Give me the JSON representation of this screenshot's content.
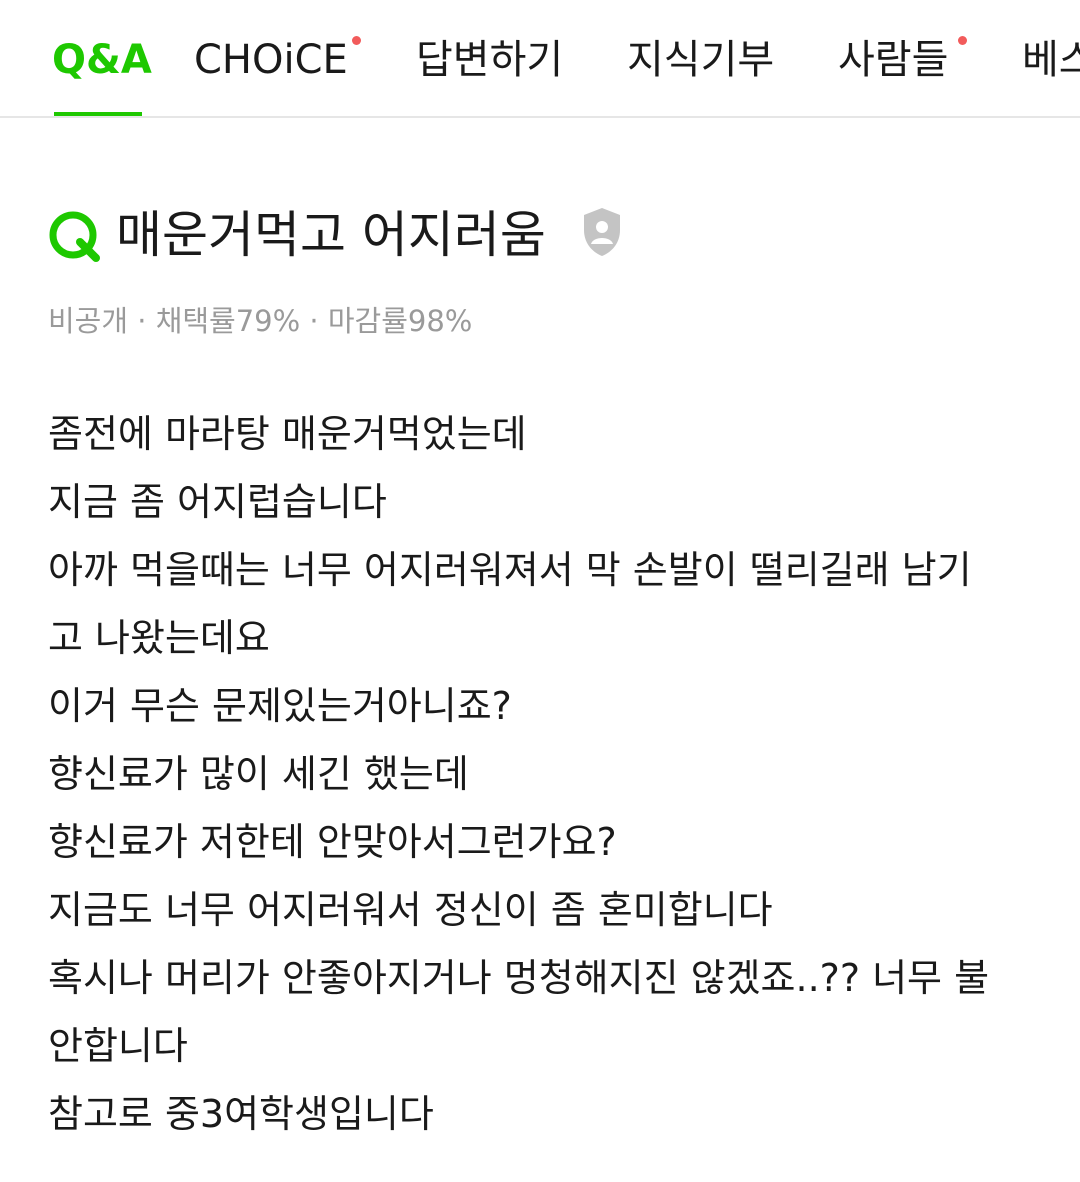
{
  "tabs": [
    {
      "label": "Q&A",
      "active": true,
      "has_dot": false
    },
    {
      "label": "CHOiCE",
      "active": false,
      "has_dot": true
    },
    {
      "label": "답변하기",
      "active": false,
      "has_dot": false
    },
    {
      "label": "지식기부",
      "active": false,
      "has_dot": false
    },
    {
      "label": "사람들",
      "active": false,
      "has_dot": true
    },
    {
      "label": "베스트",
      "active": false,
      "has_dot": false
    }
  ],
  "colors": {
    "accent": "#1ec800",
    "notification_dot": "#f25b5b",
    "meta_text": "#9a9a9a",
    "privacy_icon": "#c4c4c4"
  },
  "question": {
    "title": "매운거먹고 어지러움",
    "title_icon": "q-mark-icon",
    "privacy_icon": "private-shield-icon",
    "meta": "비공개 · 채택률79% · 마감률98%",
    "body_lines": [
      "좀전에 마라탕 매운거먹었는데",
      "지금 좀 어지럽습니다",
      "아까 먹을때는 너무 어지러워져서 막 손발이 떨리길래 남기",
      "고 나왔는데요",
      "이거 무슨 문제있는거아니죠?",
      "향신료가 많이 세긴 했는데",
      "향신료가 저한테 안맞아서그런가요?",
      "지금도 너무 어지러워서 정신이 좀 혼미합니다",
      "혹시나 머리가 안좋아지거나 멍청해지진 않겠죠..?? 너무 불",
      "안합니다",
      "참고로 중3여학생입니다"
    ]
  }
}
